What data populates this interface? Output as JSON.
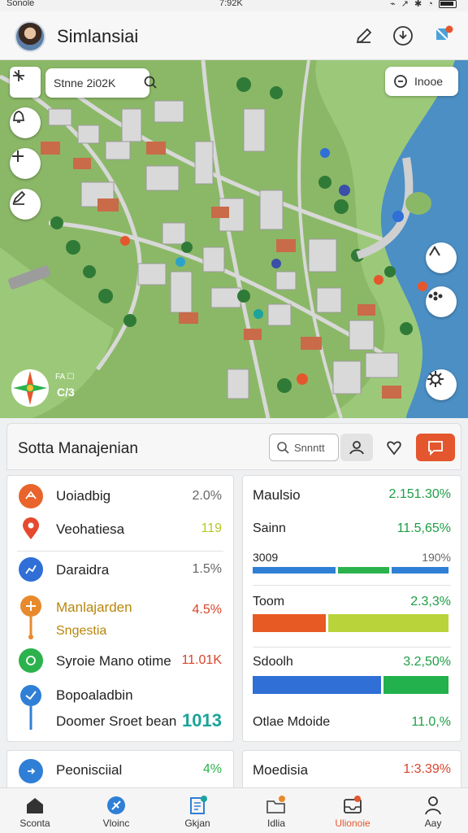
{
  "status_bar": {
    "carrier": "Sonole",
    "time": "7:92K"
  },
  "header": {
    "title": "Simlansiai"
  },
  "map": {
    "search_text": "Stnne 2i02K",
    "pill_label": "Inooe",
    "compass_label": "FA ☐",
    "compass_code": "C/3"
  },
  "panel": {
    "title": "Sotta Manajenian",
    "search_placeholder": "Snnntt"
  },
  "left_list": [
    {
      "label": "Uoiadbig",
      "value": "2.0%",
      "color": "#e8642c",
      "value_color": "#666"
    },
    {
      "label": "Veohatiesa",
      "value": "119",
      "color": "#e64a2e",
      "value_color": "#b8c728"
    },
    {
      "label": "Daraidra",
      "value": "1.5%",
      "color": "#2f6fd6",
      "value_color": "#666"
    },
    {
      "label": "Manlajarden",
      "value": "4.5%",
      "color": "#e88a2c",
      "value_color": "#d9442b"
    },
    {
      "label": "Sngestia",
      "value": "",
      "color": "#e88a2c",
      "value_color": "#666"
    },
    {
      "label": "Syroie Mano otime",
      "value": "11.01K",
      "color": "#2bb24c",
      "value_color": "#d9442b"
    },
    {
      "label": "Bopoaladbin",
      "value": "",
      "color": "#2f7fd6",
      "value_color": "#666"
    },
    {
      "label": "Doomer Sroet bean",
      "value": "1013",
      "color": "#2f7fd6",
      "value_color": "#1ba39c"
    }
  ],
  "right_metrics": [
    {
      "label": "Maulsio",
      "value": "2.151.30%",
      "value_color": "#1e9e45"
    },
    {
      "label": "Sainn",
      "value": "11.5,65%",
      "value_color": "#1e9e45"
    },
    {
      "label": "3009",
      "value": "190%",
      "value_color": "#666"
    },
    {
      "label": "Toom",
      "value": "2.3,3%",
      "value_color": "#1e9e45"
    },
    {
      "label": "Sdoolh",
      "value": "3.2,50%",
      "value_color": "#1e9e45"
    },
    {
      "label": "Otlae Mdoide",
      "value": "11.0,%",
      "value_color": "#1e9e45"
    }
  ],
  "bars": [
    {
      "fractions": [
        0.43,
        0.27,
        0.3
      ],
      "colors": [
        "#2f7fd6",
        "#2bb24c",
        "#2f7fd6"
      ]
    },
    {
      "fractions": [
        0.38,
        0.62
      ],
      "colors": [
        "#e85a23",
        "#b8d43a"
      ]
    },
    {
      "fractions": [
        0.66,
        0.34
      ],
      "colors": [
        "#2f6fd6",
        "#22b14c"
      ]
    }
  ],
  "bottom_cards": [
    {
      "label": "Peonisciial",
      "value": "4%",
      "value_color": "#2bb24c"
    },
    {
      "label": "Moedisia",
      "value": "1:3.39%",
      "value_color": "#d9442b"
    }
  ],
  "nav": [
    {
      "label": "Sconta",
      "icon": "home-icon"
    },
    {
      "label": "Vloinc",
      "icon": "compass-icon"
    },
    {
      "label": "Gkjan",
      "icon": "clipboard-icon"
    },
    {
      "label": "Idlia",
      "icon": "folder-icon"
    },
    {
      "label": "Ulionoie",
      "icon": "inbox-icon"
    },
    {
      "label": "Aay",
      "icon": "person-icon"
    }
  ],
  "colors": {
    "accent": "#e4572e",
    "water": "#4b8fc5",
    "land": "#8dbd6a"
  }
}
